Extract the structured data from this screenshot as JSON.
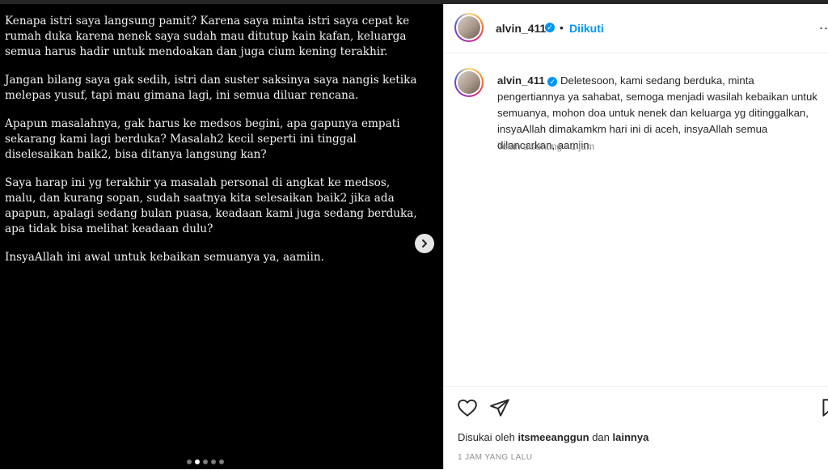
{
  "story": {
    "paragraphs": [
      "Kenapa istri saya langsung pamit? Karena saya minta istri saya cepat ke rumah duka karena nenek saya sudah mau ditutup kain kafan, keluarga semua harus hadir untuk mendoakan dan juga cium kening terakhir.",
      "Jangan bilang saya gak sedih, istri dan suster saksinya saya nangis ketika melepas yusuf, tapi mau gimana lagi, ini semua diluar rencana.",
      "Apapun masalahnya, gak harus ke medsos begini, apa gapunya empati sekarang kami lagi berduka? Masalah2 kecil seperti ini tinggal diselesaikan baik2, bisa ditanya langsung kan?",
      "Saya harap ini yg terakhir ya masalah personal di angkat ke medsos, malu, dan kurang sopan, sudah saatnya kita selesaikan baik2 jika ada apapun, apalagi sedang bulan puasa, keadaan kami juga sedang berduka, apa tidak bisa melihat keadaan dulu?",
      "InsyaAllah ini awal untuk kebaikan semuanya ya, aamiin."
    ],
    "carousel_total": 5,
    "carousel_active": 2
  },
  "header": {
    "username": "alvin_411",
    "separator": "•",
    "follow_label": "Diikuti",
    "more_label": "..."
  },
  "caption": {
    "username": "alvin_411",
    "text": "Deletesoon, kami sedang berduka, minta pengertiannya ya sahabat, semoga menjadi wasilah kebaikan untuk semuanya, mohon doa untuk nenek dan keluarga yg ditinggalkan, insyaAllah dimakamkm hari ini di aceh, insyaAllah semua dilancarkan, aamiin.",
    "meta": "Telah disunting · 1 jam"
  },
  "likes": {
    "prefix": "Disukai oleh",
    "user": "itsmeeanggun",
    "conj": "dan",
    "others": "lainnya"
  },
  "timestamp": "1 JAM YANG LALU",
  "colors": {
    "accent": "#0095f6",
    "text": "#262626",
    "muted": "#8e8e8e"
  }
}
